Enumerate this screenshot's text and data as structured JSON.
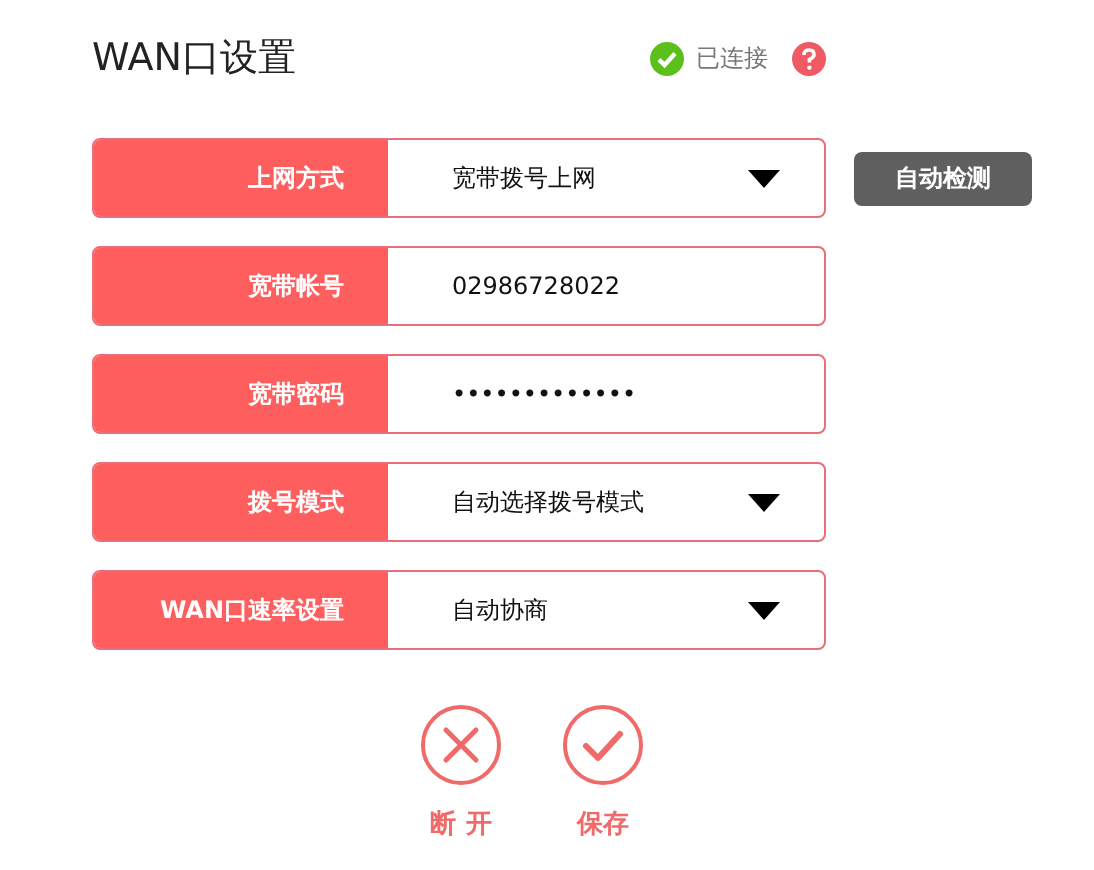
{
  "title": "WAN口设置",
  "status": {
    "connected": true,
    "label": "已连接"
  },
  "fields": [
    {
      "kind": "select",
      "label": "上网方式",
      "value": "宽带拨号上网"
    },
    {
      "kind": "text",
      "label": "宽带帐号",
      "value": "02986728022"
    },
    {
      "kind": "text",
      "label": "宽带密码",
      "value": "•••••••••••••"
    },
    {
      "kind": "select",
      "label": "拨号模式",
      "value": "自动选择拨号模式"
    },
    {
      "kind": "select",
      "label": "WAN口速率设置",
      "value": "自动协商"
    }
  ],
  "detect_button": "自动检测",
  "actions": [
    {
      "kind": "disconnect",
      "label": "断 开"
    },
    {
      "kind": "save",
      "label": "保存"
    }
  ]
}
